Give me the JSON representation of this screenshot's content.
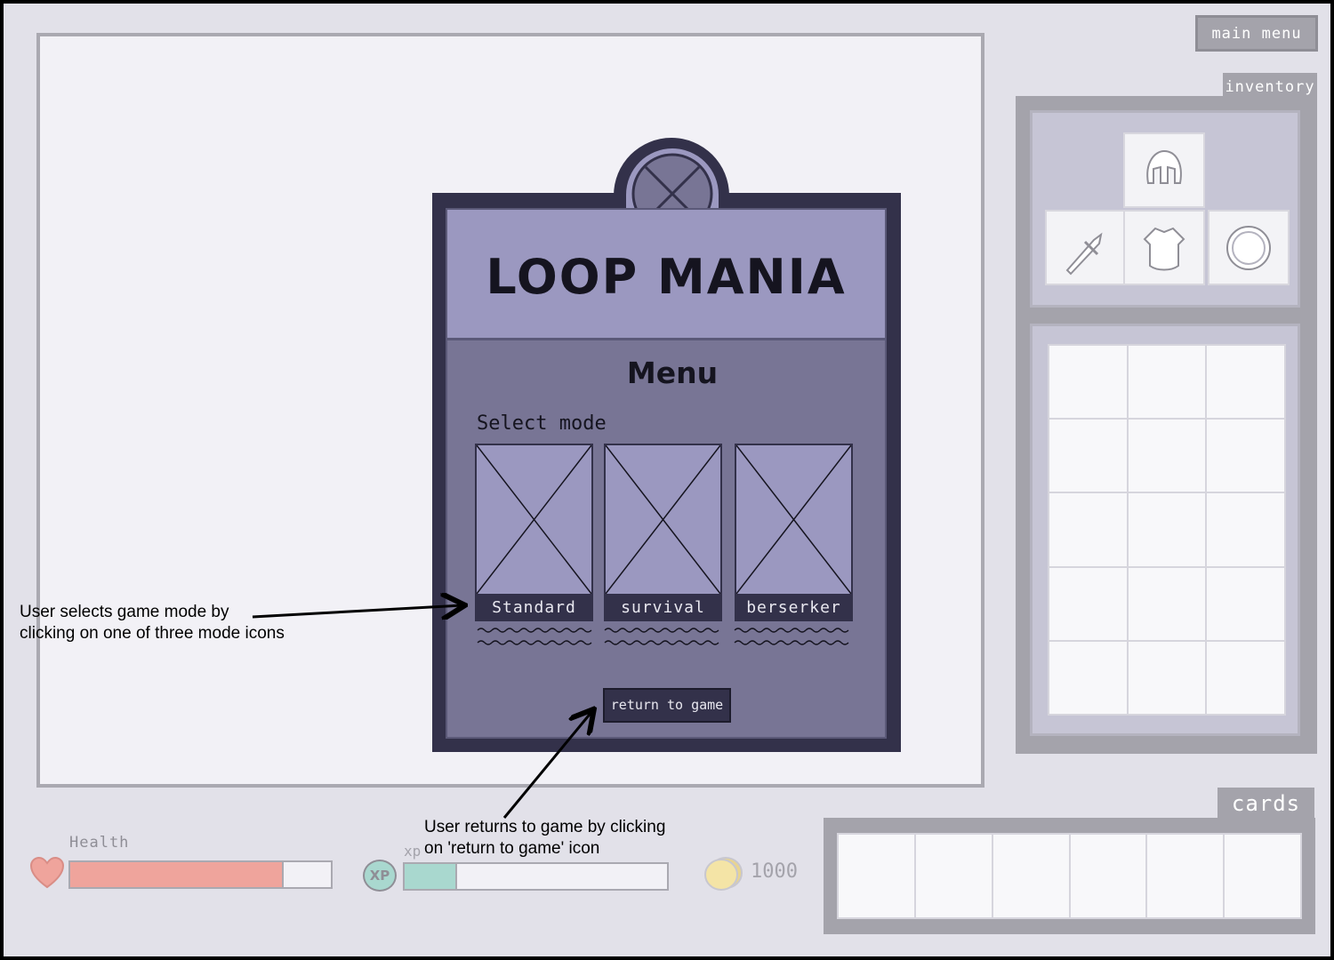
{
  "header": {
    "main_menu_label": "main menu"
  },
  "inventory": {
    "tab_label": "inventory",
    "equipment": [
      {
        "slot": "helmet",
        "icon": "helmet-icon"
      },
      {
        "slot": "weapon",
        "icon": "sword-icon"
      },
      {
        "slot": "armour",
        "icon": "armour-icon"
      },
      {
        "slot": "shield",
        "icon": "shield-icon"
      }
    ],
    "bag_rows": 5,
    "bag_cols": 3
  },
  "cards": {
    "tab_label": "cards",
    "slots": 6
  },
  "status": {
    "health_label": "Health",
    "health_fraction": 0.82,
    "xp_label": "xp",
    "xp_badge": "XP",
    "xp_fraction": 0.2,
    "gold_value": "1000"
  },
  "menu": {
    "title": "LOOP MANIA",
    "heading": "Menu",
    "select_mode_label": "Select mode",
    "modes": [
      {
        "label": "Standard"
      },
      {
        "label": "survival"
      },
      {
        "label": "berserker"
      }
    ],
    "return_label": "return to game"
  },
  "annotations": {
    "mode_note_line1": "User selects game mode by",
    "mode_note_line2": "clicking on one of three mode icons",
    "return_note_line1": "User returns to game by clicking",
    "return_note_line2": "on 'return to game' icon"
  },
  "colors": {
    "health_fill": "#efa49c",
    "xp_fill": "#a9d8cf",
    "gold": "#f4e4a6",
    "dialog_dark": "#33314a",
    "dialog_light": "#9b98c0",
    "dialog_mid": "#787595"
  }
}
